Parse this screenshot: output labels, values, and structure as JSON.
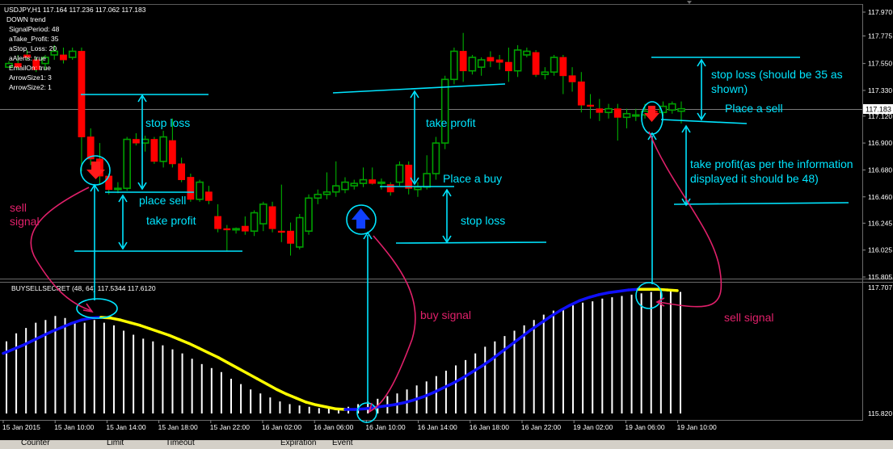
{
  "info_panel": {
    "header": "USDJPY,H1  117.164 117.236 117.062 117.183",
    "lines": [
      "DOWN trend",
      "SignalPeriod: 48",
      "aTake_Profit: 35",
      "aStop_Loss: 20",
      "aAlerts: true",
      "EmailOn: true",
      "ArrowSize1: 3",
      "ArrowSize2: 1"
    ]
  },
  "indicator_label": "BUYSELLSECRET (48, 64) 117.5344 117.6120",
  "bottom_tabs": [
    "Counter",
    "Limit",
    "Timeout",
    "Expiration",
    "Event"
  ],
  "colors": {
    "background": "#000000",
    "bull": "#00a000",
    "bear": "#ff0000",
    "wick": "#00c000",
    "annotation": "#00e5ff",
    "note": "#e0206a",
    "indicator_up": "#1010ff",
    "indicator_down": "#ffff00",
    "histogram": "#ffffff",
    "arrow_sell": "#ff1a1a",
    "arrow_buy": "#1040ff"
  },
  "chart_data": [
    {
      "type": "candlestick",
      "symbol": "USDJPY,H1",
      "ylim": [
        115.805,
        117.97
      ],
      "y_ticks": [
        "117.970",
        "117.775",
        "117.550",
        "117.330",
        "117.120",
        "116.900",
        "116.680",
        "116.460",
        "116.245",
        "116.025",
        "115.805"
      ],
      "current_price": "117.183",
      "x_ticks": [
        "15 Jan 2015",
        "15 Jan 10:00",
        "15 Jan 14:00",
        "15 Jan 18:00",
        "15 Jan 22:00",
        "16 Jan 02:00",
        "16 Jan 06:00",
        "16 Jan 10:00",
        "16 Jan 14:00",
        "16 Jan 18:00",
        "16 Jan 22:00",
        "19 Jan 02:00",
        "19 Jan 06:00",
        "19 Jan 10:00"
      ],
      "candles": [
        [
          117.52,
          117.57,
          117.52,
          117.55
        ],
        [
          117.55,
          117.62,
          117.5,
          117.52
        ],
        [
          117.62,
          117.66,
          117.58,
          117.6
        ],
        [
          117.58,
          117.6,
          117.48,
          117.5
        ],
        [
          117.55,
          117.62,
          117.5,
          117.6
        ],
        [
          117.62,
          117.7,
          117.58,
          117.65
        ],
        [
          117.62,
          117.68,
          117.55,
          117.58
        ],
        [
          117.6,
          117.68,
          117.58,
          117.65
        ],
        [
          117.65,
          117.68,
          116.67,
          116.95
        ],
        [
          116.95,
          117.02,
          116.72,
          116.77
        ],
        [
          116.77,
          116.9,
          116.56,
          116.63
        ],
        [
          116.63,
          116.65,
          116.48,
          116.52
        ],
        [
          116.52,
          116.58,
          116.49,
          116.53
        ],
        [
          116.53,
          116.95,
          116.51,
          116.93
        ],
        [
          116.93,
          116.98,
          116.88,
          116.9
        ],
        [
          116.9,
          116.96,
          116.83,
          116.93
        ],
        [
          116.93,
          116.95,
          116.73,
          116.75
        ],
        [
          116.75,
          117.0,
          116.7,
          116.95
        ],
        [
          116.92,
          117.1,
          116.7,
          116.73
        ],
        [
          116.73,
          116.78,
          116.58,
          116.6
        ],
        [
          116.62,
          116.65,
          116.42,
          116.44
        ],
        [
          116.44,
          116.6,
          116.42,
          116.58
        ],
        [
          116.5,
          116.55,
          116.4,
          116.43
        ],
        [
          116.3,
          116.4,
          116.17,
          116.2
        ],
        [
          116.2,
          116.23,
          116.02,
          116.19
        ],
        [
          116.19,
          116.21,
          116.16,
          116.2
        ],
        [
          116.22,
          116.3,
          116.15,
          116.18
        ],
        [
          116.18,
          116.35,
          116.14,
          116.33
        ],
        [
          116.24,
          116.42,
          116.18,
          116.4
        ],
        [
          116.38,
          116.42,
          116.17,
          116.2
        ],
        [
          116.18,
          116.56,
          116.09,
          116.17
        ],
        [
          116.18,
          116.25,
          115.98,
          116.08
        ],
        [
          116.05,
          116.32,
          116.03,
          116.29
        ],
        [
          116.18,
          116.48,
          116.15,
          116.45
        ],
        [
          116.45,
          116.52,
          116.4,
          116.48
        ],
        [
          116.48,
          116.66,
          116.44,
          116.5
        ],
        [
          116.5,
          116.75,
          116.46,
          116.55
        ],
        [
          116.52,
          116.62,
          116.49,
          116.58
        ],
        [
          116.55,
          116.6,
          116.52,
          116.57
        ],
        [
          116.57,
          116.7,
          116.54,
          116.6
        ],
        [
          116.6,
          116.7,
          116.56,
          116.57
        ],
        [
          116.57,
          116.61,
          116.52,
          116.58
        ],
        [
          116.56,
          116.58,
          116.47,
          116.5
        ],
        [
          116.58,
          116.75,
          116.55,
          116.72
        ],
        [
          116.72,
          116.75,
          116.48,
          116.53
        ],
        [
          116.52,
          116.58,
          116.46,
          116.54
        ],
        [
          116.54,
          116.8,
          116.52,
          116.65
        ],
        [
          116.65,
          116.95,
          116.6,
          116.9
        ],
        [
          116.9,
          117.45,
          116.85,
          117.42
        ],
        [
          117.42,
          117.68,
          117.38,
          117.65
        ],
        [
          117.65,
          117.8,
          117.4,
          117.49
        ],
        [
          117.49,
          117.62,
          117.46,
          117.6
        ],
        [
          117.52,
          117.6,
          117.45,
          117.58
        ],
        [
          117.6,
          117.65,
          117.52,
          117.57
        ],
        [
          117.58,
          117.62,
          117.5,
          117.56
        ],
        [
          117.56,
          117.68,
          117.4,
          117.49
        ],
        [
          117.49,
          117.7,
          117.44,
          117.66
        ],
        [
          117.62,
          117.68,
          117.6,
          117.65
        ],
        [
          117.64,
          117.66,
          117.44,
          117.46
        ],
        [
          117.46,
          117.52,
          117.42,
          117.48
        ],
        [
          117.48,
          117.62,
          117.45,
          117.6
        ],
        [
          117.6,
          117.62,
          117.3,
          117.45
        ],
        [
          117.45,
          117.52,
          117.32,
          117.4
        ],
        [
          117.4,
          117.48,
          117.15,
          117.21
        ],
        [
          117.21,
          117.3,
          117.1,
          117.2
        ],
        [
          117.18,
          117.26,
          117.08,
          117.15
        ],
        [
          117.15,
          117.22,
          117.1,
          117.18
        ],
        [
          117.18,
          117.22,
          116.92,
          117.11
        ],
        [
          117.11,
          117.18,
          117.02,
          117.14
        ],
        [
          117.12,
          117.18,
          117.08,
          117.13
        ],
        [
          117.13,
          117.22,
          117.1,
          117.16
        ],
        [
          117.16,
          117.2,
          117.1,
          117.15
        ],
        [
          117.15,
          117.24,
          117.12,
          117.2
        ],
        [
          117.17,
          117.24,
          117.14,
          117.22
        ],
        [
          117.16,
          117.24,
          117.06,
          117.18
        ]
      ]
    },
    {
      "type": "line+histogram",
      "name": "BUYSELLSECRET (48, 64)",
      "ylim": [
        115.82,
        117.707
      ],
      "y_ticks": [
        "117.707",
        "115.820"
      ],
      "line": [
        116.72,
        116.78,
        116.84,
        116.91,
        116.98,
        117.05,
        117.11,
        117.17,
        117.22,
        117.25,
        117.26,
        117.25,
        117.22,
        117.18,
        117.14,
        117.09,
        117.04,
        116.99,
        116.93,
        116.87,
        116.8,
        116.73,
        116.66,
        116.58,
        116.5,
        116.42,
        116.34,
        116.26,
        116.18,
        116.11,
        116.05,
        115.99,
        115.95,
        115.92,
        115.89,
        115.88,
        115.88,
        115.89,
        115.91,
        115.93,
        115.95,
        115.98,
        116.02,
        116.07,
        116.13,
        116.2,
        116.27,
        116.35,
        116.44,
        116.53,
        116.63,
        116.74,
        116.85,
        116.96,
        117.07,
        117.17,
        117.27,
        117.36,
        117.44,
        117.51,
        117.56,
        117.6,
        117.63,
        117.65,
        117.67,
        117.68,
        117.68,
        117.68,
        117.67,
        117.66
      ],
      "line_color_by_segment": [
        "up",
        "up",
        "up",
        "up",
        "up",
        "up",
        "up",
        "up",
        "up",
        "up",
        "down",
        "down",
        "down",
        "down",
        "down",
        "down",
        "down",
        "down",
        "down",
        "down",
        "down",
        "down",
        "down",
        "down",
        "down",
        "down",
        "down",
        "down",
        "down",
        "down",
        "down",
        "down",
        "down",
        "down",
        "down",
        "up",
        "up",
        "up",
        "up",
        "up",
        "up",
        "up",
        "up",
        "up",
        "up",
        "up",
        "up",
        "up",
        "up",
        "up",
        "up",
        "up",
        "up",
        "up",
        "up",
        "up",
        "up",
        "up",
        "up",
        "up",
        "up",
        "up",
        "up",
        "up",
        "up",
        "down",
        "down",
        "down",
        "down"
      ],
      "histogram": [
        116.9,
        117.02,
        117.1,
        117.18,
        117.22,
        117.28,
        117.25,
        117.2,
        117.18,
        117.22,
        117.18,
        117.14,
        117.06,
        117.0,
        116.94,
        116.9,
        116.84,
        116.78,
        116.72,
        116.64,
        116.56,
        116.5,
        116.44,
        116.34,
        116.26,
        116.18,
        116.12,
        116.06,
        116.0,
        115.96,
        115.94,
        115.92,
        115.9,
        115.9,
        115.88,
        115.92,
        115.96,
        116.0,
        116.04,
        116.08,
        116.12,
        116.18,
        116.24,
        116.3,
        116.38,
        116.46,
        116.54,
        116.62,
        116.72,
        116.82,
        116.9,
        116.98,
        117.06,
        117.14,
        117.22,
        117.3,
        117.36,
        117.4,
        117.44,
        117.48,
        117.5,
        117.54,
        117.56,
        117.58,
        117.6,
        117.62,
        117.64,
        117.66,
        117.66,
        117.64
      ]
    }
  ],
  "annotations": {
    "stop_loss_1": "stop loss",
    "place_sell_1": "place sell",
    "take_profit_1": "take profit",
    "sell_signal_1": "sell\nsignal",
    "take_profit_2": "take profit",
    "place_buy": "Place a buy",
    "stop_loss_2": "stop loss",
    "buy_signal": "buy signal",
    "stop_loss_3": "stop loss (should be 35 as\nshown)",
    "place_sell_2": "Place a sell",
    "take_profit_3": "take profit(as per the information\ndisplayed it should be 48)",
    "sell_signal_2": "sell signal"
  }
}
